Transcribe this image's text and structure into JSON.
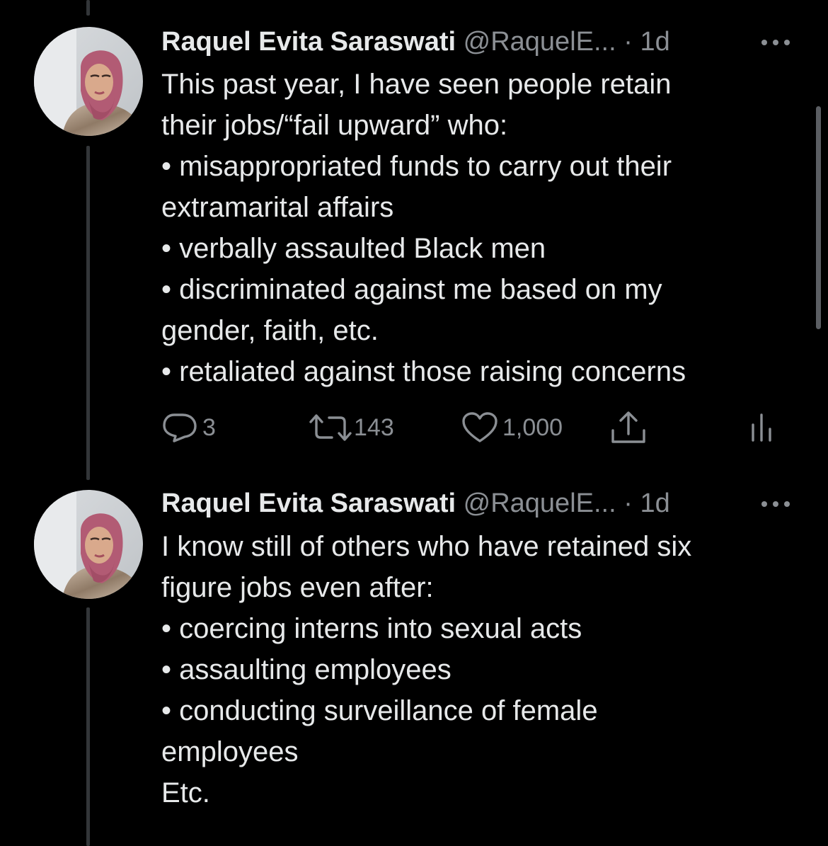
{
  "colors": {
    "background": "#000000",
    "text_primary": "#e7e9ea",
    "text_secondary": "#8b8f94",
    "thread_line": "#333639"
  },
  "tweets": [
    {
      "author_name": "Raquel Evita Saraswati",
      "handle": "@RaquelE...",
      "separator": "·",
      "time": "1d",
      "avatar": "profile-photo-woman-pink-hijab",
      "lines": [
        "This past year, I have seen people retain",
        "their jobs/“fail upward” who:",
        "• misappropriated funds to carry out their",
        "extramarital affairs",
        "• verbally assaulted Black men",
        "• discriminated against me based on my",
        "gender, faith, etc.",
        "• retaliated against those raising concerns"
      ],
      "actions": {
        "reply_icon": "reply-icon",
        "reply_count": "3",
        "retweet_icon": "retweet-icon",
        "retweet_count": "143",
        "like_icon": "heart-icon",
        "like_count": "1,000",
        "share_icon": "share-icon",
        "analytics_icon": "analytics-icon"
      }
    },
    {
      "author_name": "Raquel Evita Saraswati",
      "handle": "@RaquelE...",
      "separator": "·",
      "time": "1d",
      "avatar": "profile-photo-woman-pink-hijab",
      "lines": [
        "I know still of others who have retained six",
        "figure jobs even after:",
        "• coercing interns into sexual acts",
        "• assaulting employees",
        "• conducting surveillance of female",
        "employees",
        "Etc."
      ]
    }
  ]
}
